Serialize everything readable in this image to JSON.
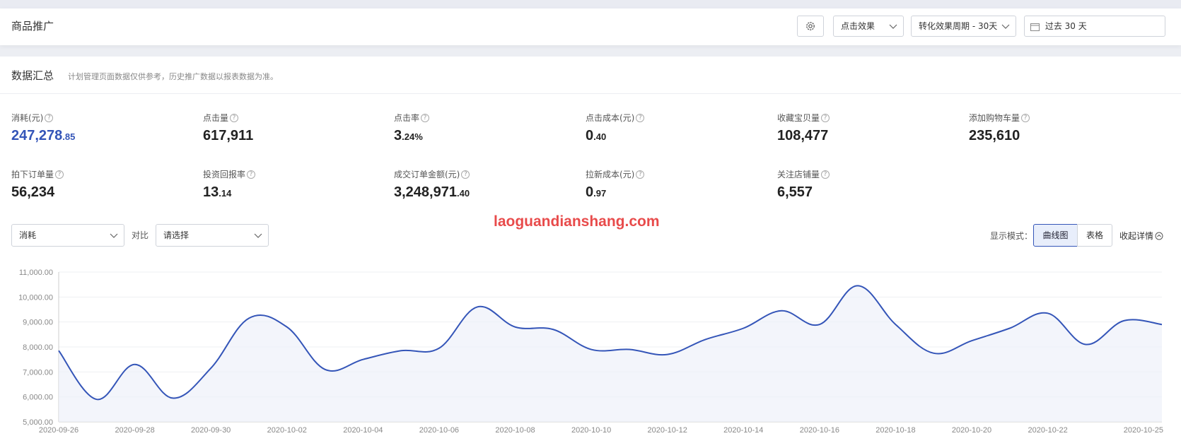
{
  "header": {
    "title": "商品推广",
    "click_effect": "点击效果",
    "period": "转化效果周期 - 30天",
    "date_range": "过去 30 天"
  },
  "summary": {
    "title": "数据汇总",
    "note": "计划管理页面数据仅供参考，历史推广数据以报表数据为准。"
  },
  "metrics": [
    {
      "label": "消耗(元)",
      "int": "247,278",
      "dec": ".85"
    },
    {
      "label": "点击量",
      "int": "617,911",
      "dec": ""
    },
    {
      "label": "点击率",
      "int": "3",
      "dec": ".24%"
    },
    {
      "label": "点击成本(元)",
      "int": "0",
      "dec": ".40"
    },
    {
      "label": "收藏宝贝量",
      "int": "108,477",
      "dec": ""
    },
    {
      "label": "添加购物车量",
      "int": "235,610",
      "dec": ""
    },
    {
      "label": "拍下订单量",
      "int": "56,234",
      "dec": ""
    },
    {
      "label": "投资回报率",
      "int": "13",
      "dec": ".14"
    },
    {
      "label": "成交订单金额(元)",
      "int": "3,248,971",
      "dec": ".40"
    },
    {
      "label": "拉新成本(元)",
      "int": "0",
      "dec": ".97"
    },
    {
      "label": "关注店铺量",
      "int": "6,557",
      "dec": ""
    }
  ],
  "controls": {
    "metric_select": "消耗",
    "compare_label": "对比",
    "compare_placeholder": "请选择",
    "mode_label": "显示模式：",
    "mode_curve": "曲线图",
    "mode_table": "表格",
    "collapse": "收起详情"
  },
  "watermark_url": "laoguandianshang.com",
  "colors": {
    "accent": "#3455b8",
    "line": "#3455b8",
    "watermark": "#e84b4b"
  },
  "chart_data": {
    "type": "line",
    "y_tick_labels": [
      "11,000.00",
      "10,000.00",
      "9,000.00",
      "8,000.00",
      "7,000.00",
      "6,000.00",
      "5,000.00"
    ],
    "ylim": [
      5000,
      11000
    ],
    "x_tick_labels": [
      "2020-09-26",
      "2020-09-28",
      "2020-09-30",
      "2020-10-02",
      "2020-10-04",
      "2020-10-06",
      "2020-10-08",
      "2020-10-10",
      "2020-10-12",
      "2020-10-14",
      "2020-10-16",
      "2020-10-18",
      "2020-10-20",
      "2020-10-22",
      "2020-10-25"
    ],
    "x": [
      "2020-09-26",
      "2020-09-27",
      "2020-09-28",
      "2020-09-29",
      "2020-09-30",
      "2020-10-01",
      "2020-10-02",
      "2020-10-03",
      "2020-10-04",
      "2020-10-05",
      "2020-10-06",
      "2020-10-07",
      "2020-10-08",
      "2020-10-09",
      "2020-10-10",
      "2020-10-11",
      "2020-10-12",
      "2020-10-13",
      "2020-10-14",
      "2020-10-15",
      "2020-10-16",
      "2020-10-17",
      "2020-10-18",
      "2020-10-19",
      "2020-10-20",
      "2020-10-21",
      "2020-10-22",
      "2020-10-23",
      "2020-10-24",
      "2020-10-25"
    ],
    "values": [
      7850,
      5900,
      7300,
      5950,
      7150,
      9150,
      8800,
      7100,
      7500,
      7850,
      7950,
      9600,
      8800,
      8700,
      7900,
      7900,
      7700,
      8300,
      8750,
      9450,
      8900,
      10450,
      8900,
      7750,
      8250,
      8750,
      9350,
      8100,
      9050,
      8900
    ],
    "grid": true
  }
}
